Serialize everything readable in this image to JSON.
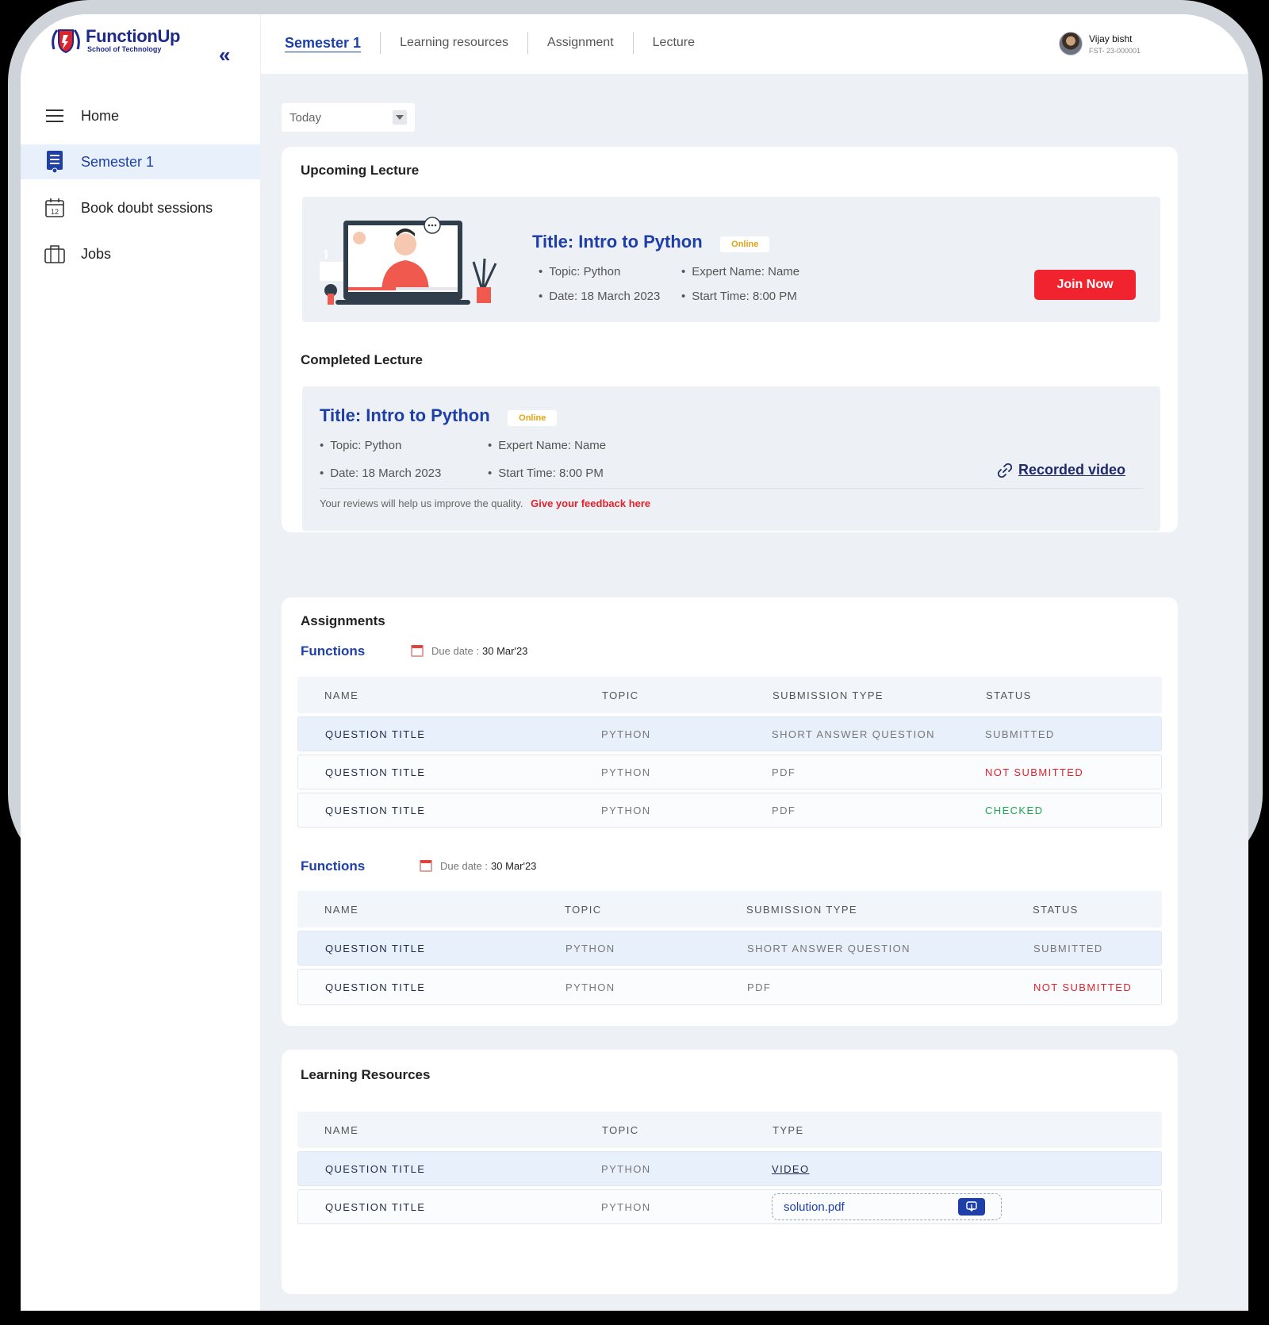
{
  "brand": {
    "name": "FunctionUp",
    "tagline": "School of Technology",
    "collapse_icon": "«"
  },
  "sidebar": {
    "items": [
      {
        "label": "Home",
        "icon": "menu-icon",
        "active": false
      },
      {
        "label": "Semester 1",
        "icon": "document-icon",
        "active": true
      },
      {
        "label": "Book doubt sessions",
        "icon": "calendar-icon",
        "active": false
      },
      {
        "label": "Jobs",
        "icon": "briefcase-icon",
        "active": false
      }
    ],
    "calendar_day": "12"
  },
  "tabs": [
    {
      "label": "Semester 1",
      "active": true
    },
    {
      "label": "Learning resources",
      "active": false
    },
    {
      "label": "Assignment",
      "active": false
    },
    {
      "label": "Lecture",
      "active": false
    }
  ],
  "user": {
    "name": "Vijay bisht",
    "id": "FST- 23-000001"
  },
  "filter": {
    "value": "Today"
  },
  "upcoming": {
    "heading": "Upcoming Lecture",
    "title": "Title: Intro to Python",
    "badge": "Online",
    "topic": "Topic: Python",
    "expert": "Expert Name: Name",
    "date": "Date: 18 March 2023",
    "start": "Start Time: 8:00 PM",
    "cta": "Join Now"
  },
  "completed": {
    "heading": "Completed Lecture",
    "title": "Title: Intro to Python",
    "badge": "Online",
    "topic": "Topic: Python",
    "expert": "Expert Name: Name",
    "date": "Date: 18 March 2023",
    "start": "Start Time: 8:00 PM",
    "recorded": "Recorded video",
    "feedback_text": "Your reviews will help us improve the quality.",
    "feedback_link": "Give your feedback here"
  },
  "assignments": {
    "heading": "Assignments",
    "groups": [
      {
        "title": "Functions",
        "due_label": "Due date :",
        "due_value": "30 Mar'23",
        "columns": [
          "NAME",
          "TOPIC",
          "SUBMISSION TYPE",
          "STATUS"
        ],
        "rows": [
          {
            "name": "QUESTION TITLE",
            "topic": "PYTHON",
            "type": "SHORT ANSWER QUESTION",
            "status": "SUBMITTED"
          },
          {
            "name": "QUESTION TITLE",
            "topic": "PYTHON",
            "type": "PDF",
            "status": "NOT SUBMITTED"
          },
          {
            "name": "QUESTION TITLE",
            "topic": "PYTHON",
            "type": "PDF",
            "status": "CHECKED"
          }
        ]
      },
      {
        "title": "Functions",
        "due_label": "Due date :",
        "due_value": "30 Mar'23",
        "columns": [
          "NAME",
          "TOPIC",
          "SUBMISSION TYPE",
          "STATUS"
        ],
        "rows": [
          {
            "name": "QUESTION TITLE",
            "topic": "PYTHON",
            "type": "SHORT ANSWER QUESTION",
            "status": "SUBMITTED"
          },
          {
            "name": "QUESTION TITLE",
            "topic": "PYTHON",
            "type": "PDF",
            "status": "NOT SUBMITTED"
          }
        ]
      }
    ]
  },
  "resources": {
    "heading": "Learning Resources",
    "columns": [
      "NAME",
      "TOPIC",
      "TYPE"
    ],
    "rows": [
      {
        "name": "QUESTION TITLE",
        "topic": "PYTHON",
        "type": "VIDEO"
      },
      {
        "name": "QUESTION TITLE",
        "topic": "PYTHON",
        "file": "solution.pdf"
      }
    ]
  },
  "colors": {
    "primary": "#1e3fa8",
    "danger": "#f0232e",
    "success": "#1aa94a",
    "warning": "#e0a412"
  }
}
